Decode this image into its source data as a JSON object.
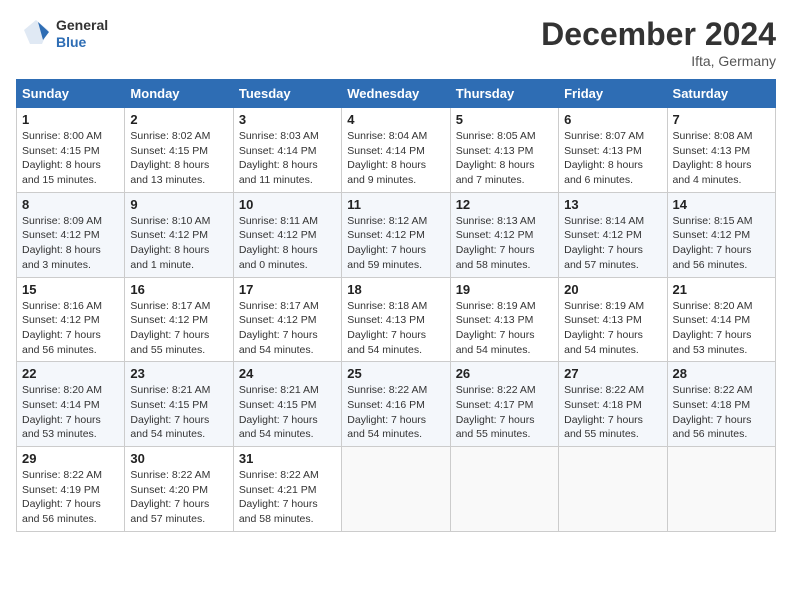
{
  "header": {
    "logo_general": "General",
    "logo_blue": "Blue",
    "month": "December 2024",
    "location": "Ifta, Germany"
  },
  "weekdays": [
    "Sunday",
    "Monday",
    "Tuesday",
    "Wednesday",
    "Thursday",
    "Friday",
    "Saturday"
  ],
  "weeks": [
    [
      {
        "day": "1",
        "sunrise": "8:00 AM",
        "sunset": "4:15 PM",
        "daylight": "8 hours and 15 minutes."
      },
      {
        "day": "2",
        "sunrise": "8:02 AM",
        "sunset": "4:15 PM",
        "daylight": "8 hours and 13 minutes."
      },
      {
        "day": "3",
        "sunrise": "8:03 AM",
        "sunset": "4:14 PM",
        "daylight": "8 hours and 11 minutes."
      },
      {
        "day": "4",
        "sunrise": "8:04 AM",
        "sunset": "4:14 PM",
        "daylight": "8 hours and 9 minutes."
      },
      {
        "day": "5",
        "sunrise": "8:05 AM",
        "sunset": "4:13 PM",
        "daylight": "8 hours and 7 minutes."
      },
      {
        "day": "6",
        "sunrise": "8:07 AM",
        "sunset": "4:13 PM",
        "daylight": "8 hours and 6 minutes."
      },
      {
        "day": "7",
        "sunrise": "8:08 AM",
        "sunset": "4:13 PM",
        "daylight": "8 hours and 4 minutes."
      }
    ],
    [
      {
        "day": "8",
        "sunrise": "8:09 AM",
        "sunset": "4:12 PM",
        "daylight": "8 hours and 3 minutes."
      },
      {
        "day": "9",
        "sunrise": "8:10 AM",
        "sunset": "4:12 PM",
        "daylight": "8 hours and 1 minute."
      },
      {
        "day": "10",
        "sunrise": "8:11 AM",
        "sunset": "4:12 PM",
        "daylight": "8 hours and 0 minutes."
      },
      {
        "day": "11",
        "sunrise": "8:12 AM",
        "sunset": "4:12 PM",
        "daylight": "7 hours and 59 minutes."
      },
      {
        "day": "12",
        "sunrise": "8:13 AM",
        "sunset": "4:12 PM",
        "daylight": "7 hours and 58 minutes."
      },
      {
        "day": "13",
        "sunrise": "8:14 AM",
        "sunset": "4:12 PM",
        "daylight": "7 hours and 57 minutes."
      },
      {
        "day": "14",
        "sunrise": "8:15 AM",
        "sunset": "4:12 PM",
        "daylight": "7 hours and 56 minutes."
      }
    ],
    [
      {
        "day": "15",
        "sunrise": "8:16 AM",
        "sunset": "4:12 PM",
        "daylight": "7 hours and 56 minutes."
      },
      {
        "day": "16",
        "sunrise": "8:17 AM",
        "sunset": "4:12 PM",
        "daylight": "7 hours and 55 minutes."
      },
      {
        "day": "17",
        "sunrise": "8:17 AM",
        "sunset": "4:12 PM",
        "daylight": "7 hours and 54 minutes."
      },
      {
        "day": "18",
        "sunrise": "8:18 AM",
        "sunset": "4:13 PM",
        "daylight": "7 hours and 54 minutes."
      },
      {
        "day": "19",
        "sunrise": "8:19 AM",
        "sunset": "4:13 PM",
        "daylight": "7 hours and 54 minutes."
      },
      {
        "day": "20",
        "sunrise": "8:19 AM",
        "sunset": "4:13 PM",
        "daylight": "7 hours and 54 minutes."
      },
      {
        "day": "21",
        "sunrise": "8:20 AM",
        "sunset": "4:14 PM",
        "daylight": "7 hours and 53 minutes."
      }
    ],
    [
      {
        "day": "22",
        "sunrise": "8:20 AM",
        "sunset": "4:14 PM",
        "daylight": "7 hours and 53 minutes."
      },
      {
        "day": "23",
        "sunrise": "8:21 AM",
        "sunset": "4:15 PM",
        "daylight": "7 hours and 54 minutes."
      },
      {
        "day": "24",
        "sunrise": "8:21 AM",
        "sunset": "4:15 PM",
        "daylight": "7 hours and 54 minutes."
      },
      {
        "day": "25",
        "sunrise": "8:22 AM",
        "sunset": "4:16 PM",
        "daylight": "7 hours and 54 minutes."
      },
      {
        "day": "26",
        "sunrise": "8:22 AM",
        "sunset": "4:17 PM",
        "daylight": "7 hours and 55 minutes."
      },
      {
        "day": "27",
        "sunrise": "8:22 AM",
        "sunset": "4:18 PM",
        "daylight": "7 hours and 55 minutes."
      },
      {
        "day": "28",
        "sunrise": "8:22 AM",
        "sunset": "4:18 PM",
        "daylight": "7 hours and 56 minutes."
      }
    ],
    [
      {
        "day": "29",
        "sunrise": "8:22 AM",
        "sunset": "4:19 PM",
        "daylight": "7 hours and 56 minutes."
      },
      {
        "day": "30",
        "sunrise": "8:22 AM",
        "sunset": "4:20 PM",
        "daylight": "7 hours and 57 minutes."
      },
      {
        "day": "31",
        "sunrise": "8:22 AM",
        "sunset": "4:21 PM",
        "daylight": "7 hours and 58 minutes."
      },
      null,
      null,
      null,
      null
    ]
  ]
}
